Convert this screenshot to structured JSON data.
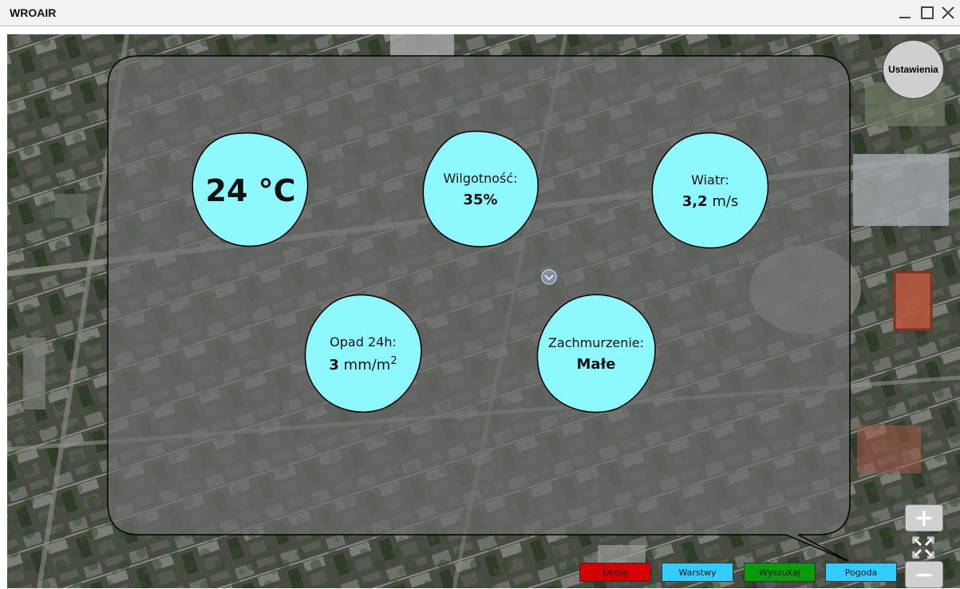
{
  "window": {
    "title": "WROAIR"
  },
  "weather": {
    "temperature": "24 °C",
    "humidity": {
      "label": "Wilgotność:",
      "value": "35%"
    },
    "wind": {
      "label": "Wiatr:",
      "value": "3,2",
      "unit": "m/s"
    },
    "precip": {
      "label": "Opad 24h:",
      "value": "3",
      "unit": "mm/m",
      "unit_sup": "2"
    },
    "cloud": {
      "label": "Zachmurzenie:",
      "value": "Małe"
    }
  },
  "settings": {
    "label": "Ustawienia"
  },
  "map_controls": {
    "zoom_in": "+",
    "zoom_out": "−"
  },
  "nav": {
    "add": "Dodaj",
    "layers": "Warstwy",
    "search": "Wyszukaj",
    "weather": "Pogoda"
  },
  "colors": {
    "bubble": "#8ef8ff",
    "panel": "#6e6e6e",
    "add": "#d40000",
    "layers": "#33ccff",
    "search": "#0a9a0a",
    "weather": "#33ccff"
  }
}
